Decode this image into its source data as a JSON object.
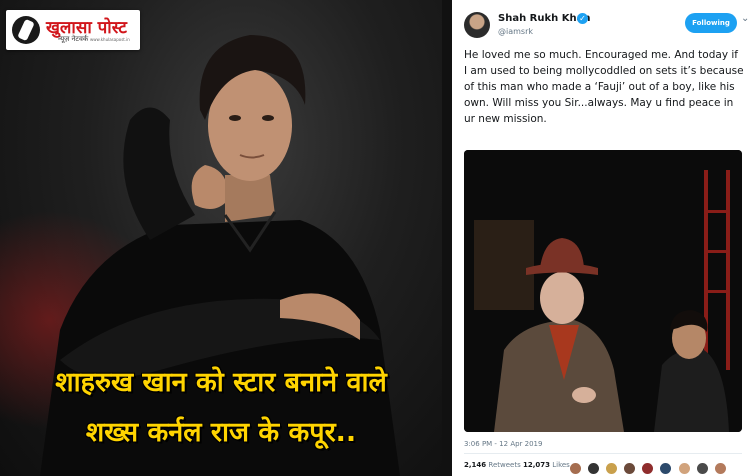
{
  "logo": {
    "title": "खुलासा पोस्ट",
    "subtitle": "न्यूज़ नेटवर्क",
    "url": "www.khulasapost.in"
  },
  "headline": {
    "line1": "शाहरुख खान को स्टार बनाने वाले",
    "line2": "शख्स कर्नल राज के कपूर.."
  },
  "tweet": {
    "name": "Shah Rukh Khan",
    "handle": "@iamsrk",
    "follow_label": "Following",
    "text": "He loved me so much. Encouraged me. And today if I am used to being mollycoddled on sets it’s because of this man who made a ‘Fauji’ out of a boy, like his own. Will miss you Sir...always. May u find peace in ur new mission.",
    "timestamp": "3:06 PM - 12 Apr 2019",
    "retweets_count": "2,146",
    "retweets_label": "Retweets",
    "likes_count": "12,073",
    "likes_label": "Likes"
  },
  "colors": {
    "headline": "#ffd400",
    "logo_red": "#d1161b",
    "twitter_blue": "#1da1f2"
  },
  "icons": {
    "verified": "verified-badge-icon",
    "dropdown": "chevron-down-icon",
    "logo": "pen-hand-icon"
  }
}
